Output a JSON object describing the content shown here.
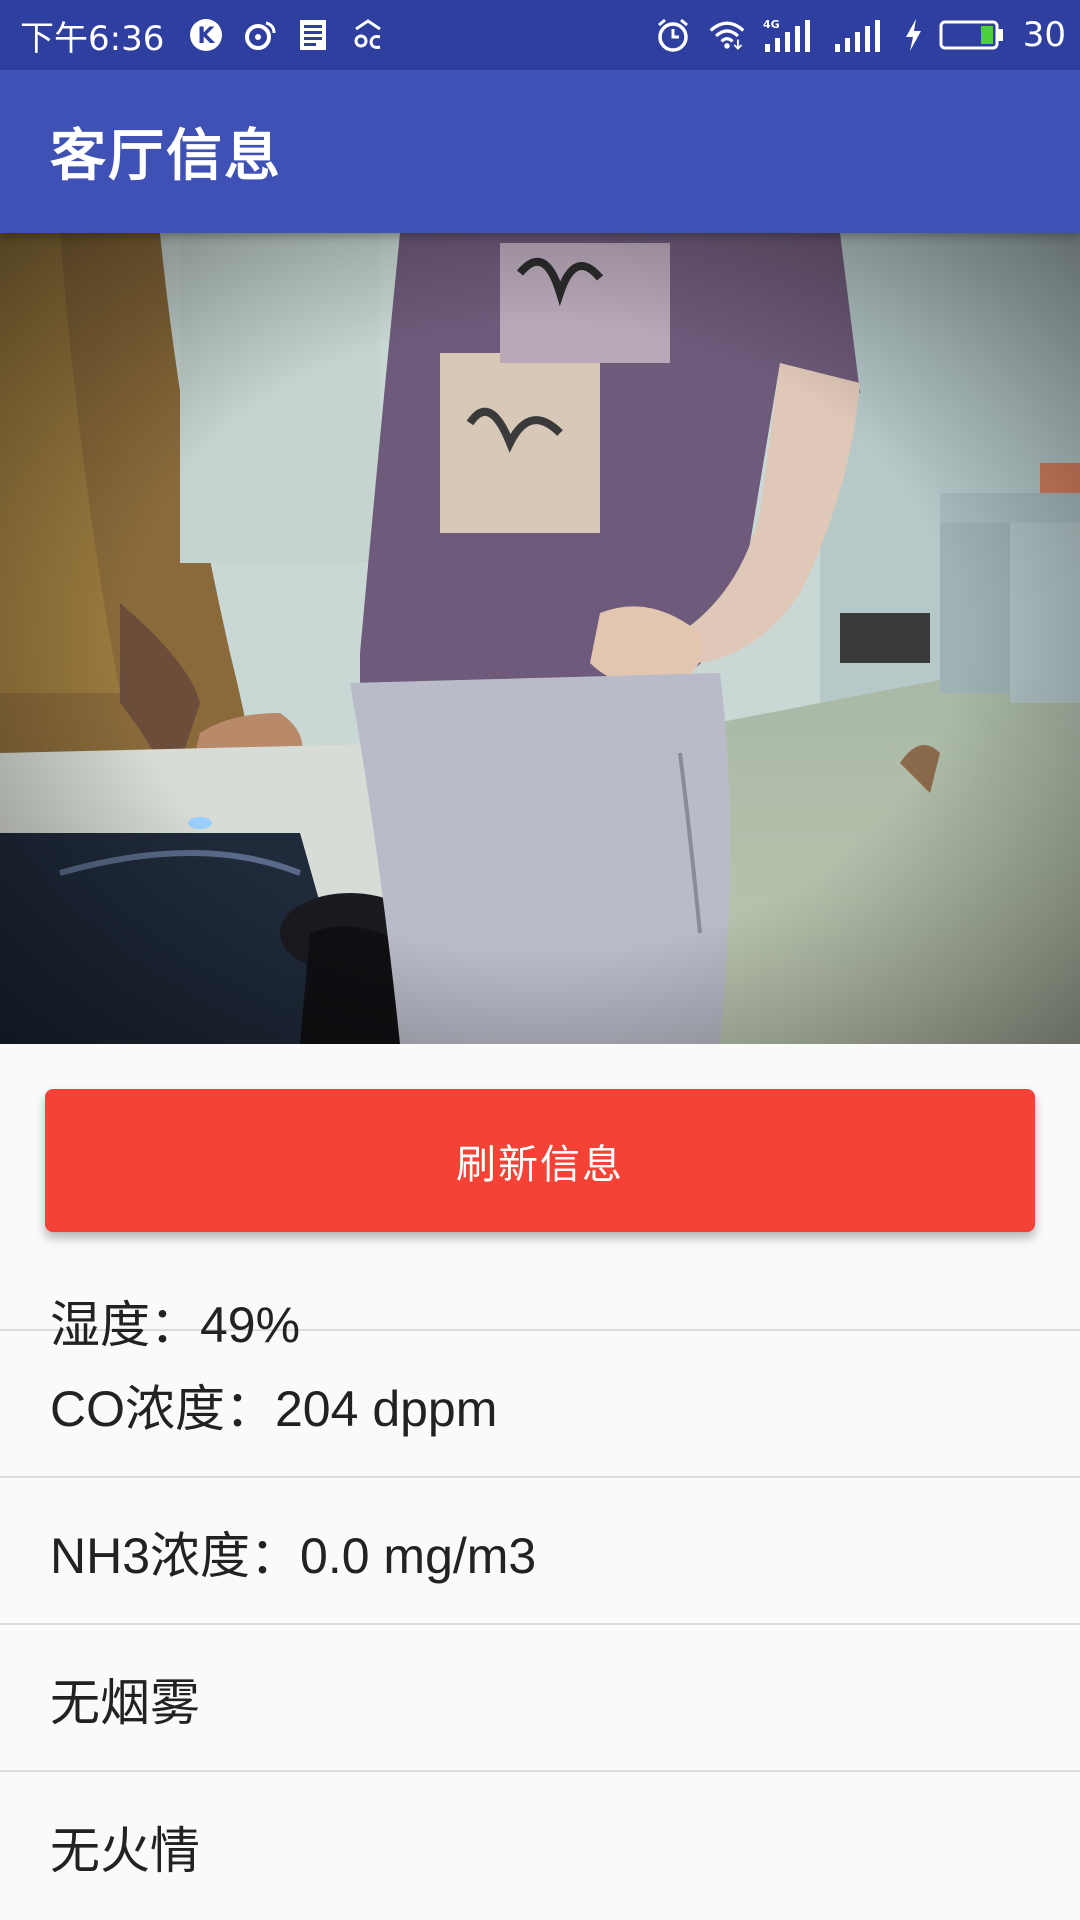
{
  "status_bar": {
    "time": "下午6:36",
    "battery_level": "30",
    "left_icons": [
      "k-app-icon",
      "weibo-icon",
      "news-icon",
      "cloud-icon"
    ],
    "right_icons": [
      "alarm-icon",
      "wifi-icon",
      "signal-4g-icon",
      "signal-icon",
      "charging-icon",
      "battery-icon"
    ]
  },
  "app_bar": {
    "title": "客厅信息"
  },
  "camera": {
    "icon": "camera-feed-image"
  },
  "refresh_button": {
    "label": "刷新信息"
  },
  "info_list": {
    "items": [
      {
        "text": "湿度：49%"
      },
      {
        "text": "CO浓度：204 dppm"
      },
      {
        "text": "NH3浓度：0.0 mg/m3"
      },
      {
        "text": "无烟雾"
      },
      {
        "text": "无火情"
      }
    ]
  },
  "colors": {
    "status_bar": "#2f3f9f",
    "app_bar": "#3f51b5",
    "button": "#f44336",
    "background": "#fafafa"
  }
}
